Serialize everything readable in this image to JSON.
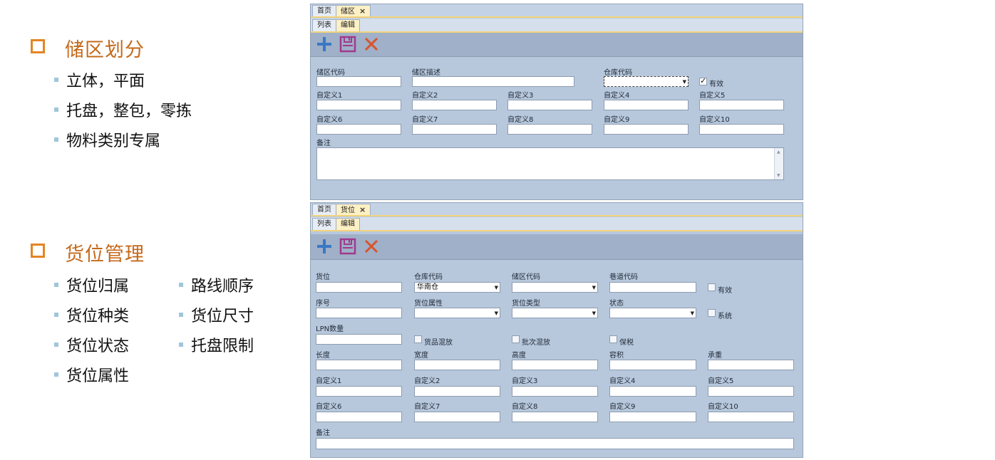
{
  "slide": {
    "section1": {
      "title": "储区划分",
      "items": [
        "立体，平面",
        "托盘，整包，零拣",
        "物料类别专属"
      ]
    },
    "section2": {
      "title": "货位管理",
      "items_left": [
        "货位归属",
        "货位种类",
        "货位状态",
        "货位属性"
      ],
      "items_right": [
        "路线顺序",
        "货位尺寸",
        "托盘限制"
      ]
    }
  },
  "colors": {
    "section_title": "#c4691b",
    "section_bullet": "#e48524",
    "item_bullet": "#9fc6dc",
    "panel_bg": "#b8c8dc",
    "toolbar_bg": "#9fb0c8",
    "add_icon": "#3a78c4",
    "save_icon": "#a03a8c",
    "delete_icon": "#d9532c"
  },
  "panel1": {
    "tabs": [
      "首页",
      "储区"
    ],
    "active_tab": "储区",
    "close_glyph": "×",
    "subtabs": [
      "列表",
      "编辑"
    ],
    "active_subtab": "编辑",
    "toolbar_icons": [
      "add-icon",
      "save-icon",
      "delete-icon"
    ],
    "labels": {
      "code": "储区代码",
      "desc": "储区描述",
      "warehouse": "仓库代码",
      "valid": "有效",
      "c1": "自定义1",
      "c2": "自定义2",
      "c3": "自定义3",
      "c4": "自定义4",
      "c5": "自定义5",
      "c6": "自定义6",
      "c7": "自定义7",
      "c8": "自定义8",
      "c9": "自定义9",
      "c10": "自定义10",
      "remark": "备注"
    },
    "valid_checked": true
  },
  "panel2": {
    "tabs": [
      "首页",
      "货位"
    ],
    "active_tab": "货位",
    "close_glyph": "×",
    "subtabs": [
      "列表",
      "编辑"
    ],
    "active_subtab": "编辑",
    "toolbar_icons": [
      "add-icon",
      "save-icon",
      "delete-icon"
    ],
    "labels": {
      "location": "货位",
      "warehouse": "仓库代码",
      "zone": "储区代码",
      "aisle": "巷道代码",
      "valid": "有效",
      "seq": "序号",
      "attr": "货位属性",
      "type": "货位类型",
      "status": "状态",
      "system": "系统",
      "lpn": "LPN数量",
      "mix_goods": "货品混放",
      "mix_batch": "批次混放",
      "bonded": "保税",
      "length": "长度",
      "width": "宽度",
      "height": "高度",
      "volume": "容积",
      "load": "承重",
      "c1": "自定义1",
      "c2": "自定义2",
      "c3": "自定义3",
      "c4": "自定义4",
      "c5": "自定义5",
      "c6": "自定义6",
      "c7": "自定义7",
      "c8": "自定义8",
      "c9": "自定义9",
      "c10": "自定义10",
      "remark": "备注"
    },
    "values": {
      "warehouse": "华南仓"
    },
    "select_arrow": "▼"
  }
}
